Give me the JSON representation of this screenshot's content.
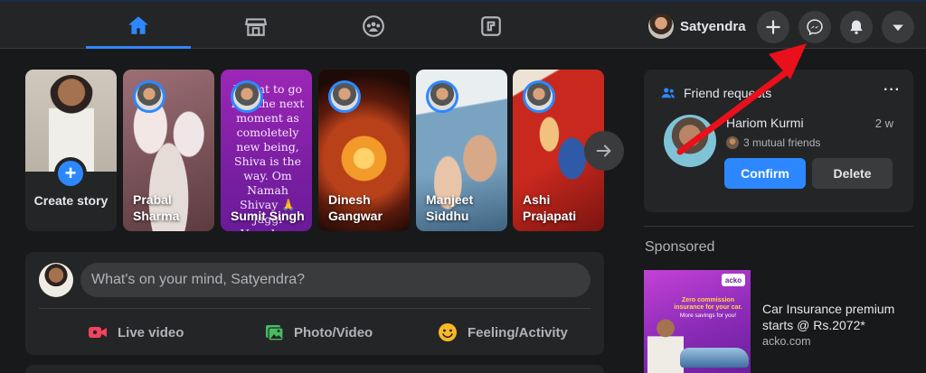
{
  "header": {
    "nav_tabs": [
      {
        "name": "home",
        "icon": "home-icon",
        "active": true
      },
      {
        "name": "marketplace",
        "icon": "store-icon",
        "active": false
      },
      {
        "name": "groups",
        "icon": "groups-icon",
        "active": false
      },
      {
        "name": "gaming",
        "icon": "gaming-icon",
        "active": false
      }
    ],
    "profile_name": "Satyendra",
    "actions": [
      "plus-icon",
      "messenger-icon",
      "bell-icon",
      "caret-down-icon"
    ]
  },
  "stories": {
    "create_label": "Create story",
    "items": [
      {
        "name": "Prabal Sharma",
        "background": "#b08a8a"
      },
      {
        "name": "Sumit Singh",
        "background": "#8a1f9e",
        "text": "I want to go into the next moment as comoletely new being, Shiva is the way. Om Namah Shivay 🙏 Jaggi Vasudeva"
      },
      {
        "name": "Dinesh Gangwar",
        "background": "#c9451c"
      },
      {
        "name": "Manjeet Siddhu",
        "background": "#6c8fa6"
      },
      {
        "name": "Ashi Prajapati",
        "background": "#b3261e"
      }
    ]
  },
  "composer": {
    "placeholder": "What's on your mind, Satyendra?",
    "actions": [
      {
        "label": "Live video",
        "icon": "live-video-icon",
        "color": "#f3425f"
      },
      {
        "label": "Photo/Video",
        "icon": "photo-icon",
        "color": "#45bd62"
      },
      {
        "label": "Feeling/Activity",
        "icon": "feeling-icon",
        "color": "#f7b928"
      }
    ]
  },
  "friend_requests": {
    "title": "Friend requests",
    "more": "···",
    "name": "Hariom Kurmi",
    "time": "2 w",
    "mutual": "3 mutual friends",
    "confirm_label": "Confirm",
    "delete_label": "Delete"
  },
  "sponsored": {
    "title": "Sponsored",
    "ad_title": "Car Insurance premium starts @ Rs.2072*",
    "ad_domain": "acko.com",
    "ad_logo": "acko",
    "ad_headline": "Zero commission insurance for your car.",
    "ad_subline": "More savings for you!"
  },
  "colors": {
    "accent": "#2d88ff",
    "annotation": "#e8101a",
    "background": "#18191a",
    "surface": "#242526"
  }
}
